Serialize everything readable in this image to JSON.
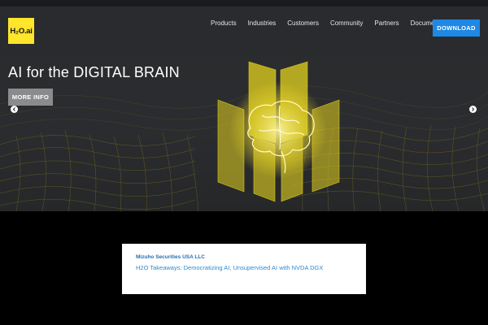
{
  "brand": {
    "logo_text": "H₂O.ai",
    "color": "#ffe52c"
  },
  "nav": {
    "items": [
      "Products",
      "Industries",
      "Customers",
      "Community",
      "Partners",
      "Documentation"
    ],
    "download_label": "DOWNLOAD",
    "download_color": "#1e88e5"
  },
  "hero": {
    "headline": "AI for the DIGITAL BRAIN",
    "more_info_label": "MORE INFO",
    "prev_icon": "chevron-left-icon",
    "next_icon": "chevron-right-icon",
    "art_icon": "brain-hexagon-icon",
    "art_color": "#e3d21f"
  },
  "news": {
    "company": "Mizuho Securities USA LLC",
    "title": "H2O Takeaways: Democratizing AI, Unsupervised AI with NVDA DGX"
  }
}
